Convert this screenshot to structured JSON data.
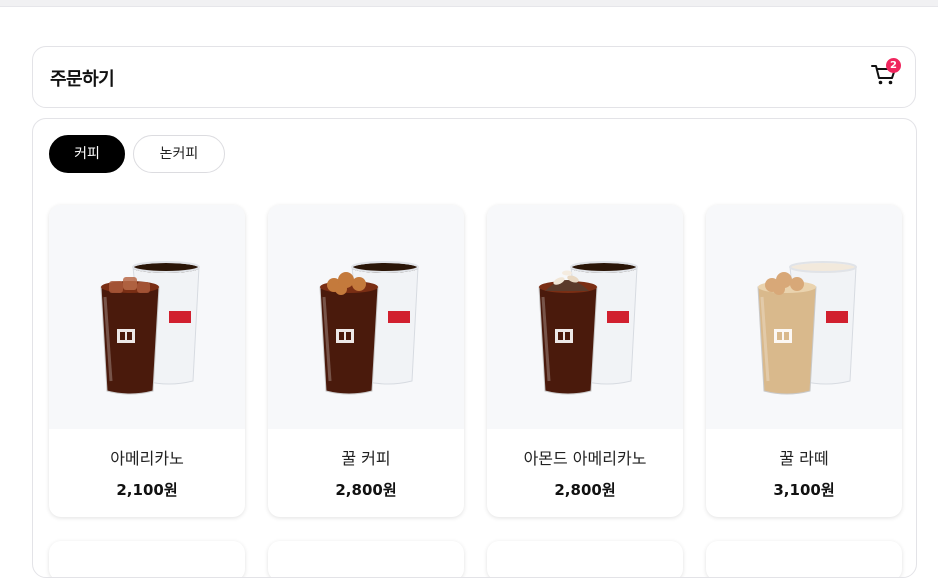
{
  "header": {
    "title": "주문하기",
    "cart_count": "2"
  },
  "tabs": [
    {
      "label": "커피",
      "active": true
    },
    {
      "label": "논커피",
      "active": false
    }
  ],
  "products": [
    {
      "name": "아메리카노",
      "price": "2,100원",
      "drink": "americano",
      "topping": "ice"
    },
    {
      "name": "꿀 커피",
      "price": "2,800원",
      "drink": "americano",
      "topping": "honeycomb"
    },
    {
      "name": "아몬드 아메리카노",
      "price": "2,800원",
      "drink": "americano",
      "topping": "almond"
    },
    {
      "name": "꿀 라떼",
      "price": "3,100원",
      "drink": "latte",
      "topping": "honeycomb"
    }
  ],
  "colors": {
    "accent": "#000000",
    "badge": "#f0265e",
    "card_image_bg": "#f7f8fa",
    "brand_red": "#d1202f"
  }
}
